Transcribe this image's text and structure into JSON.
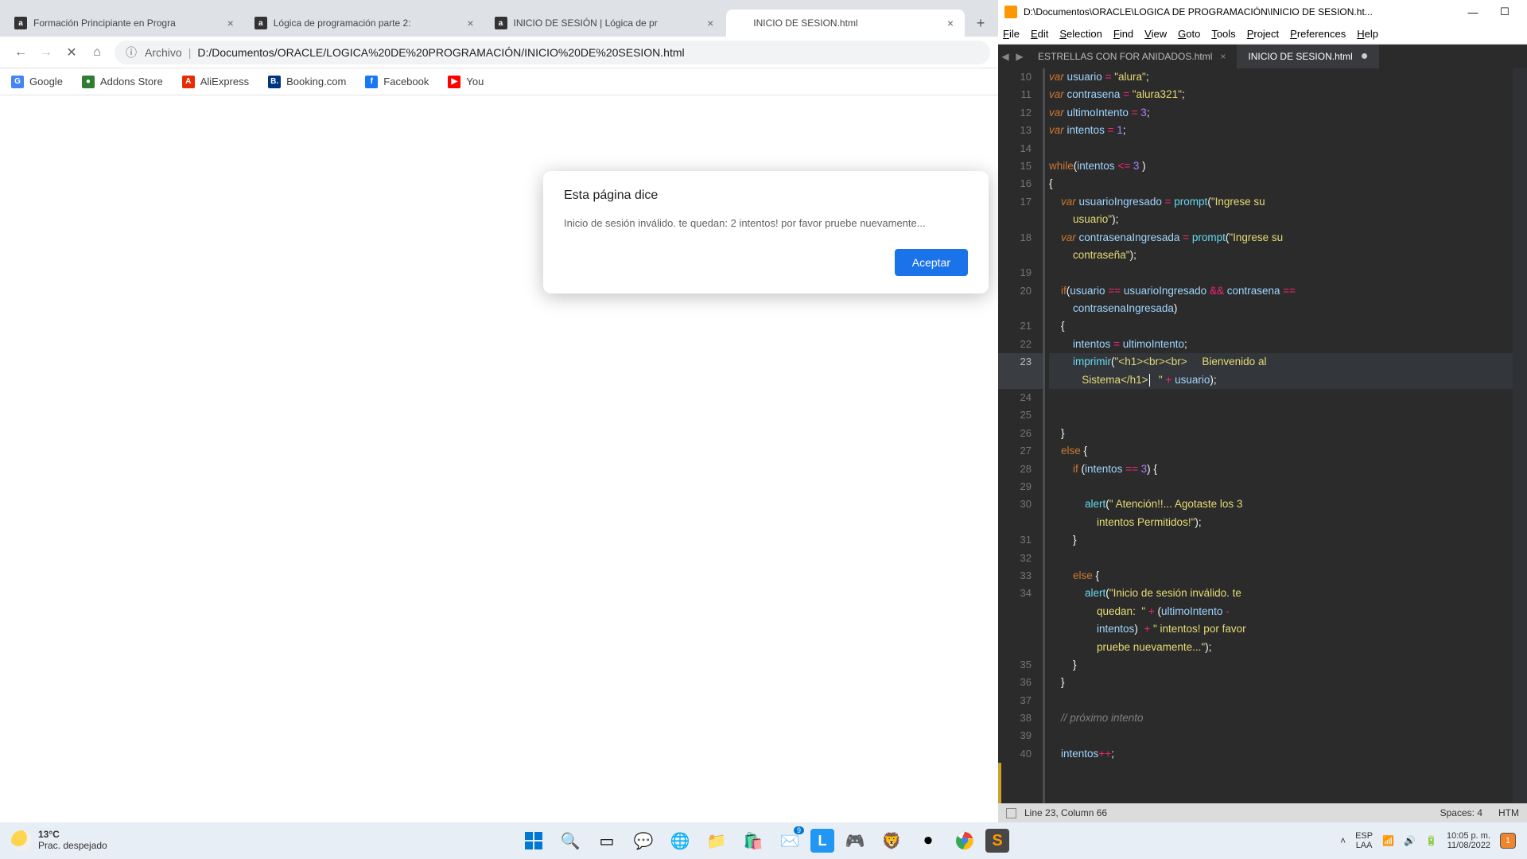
{
  "chrome": {
    "tabs": [
      {
        "title": "Formación Principiante en Progra"
      },
      {
        "title": "Lógica de programación parte 2:"
      },
      {
        "title": "INICIO DE SESIÓN | Lógica de pr"
      },
      {
        "title": "INICIO DE SESION.html"
      }
    ],
    "address": {
      "info_label": "Archivo",
      "url": "D:/Documentos/ORACLE/LOGICA%20DE%20PROGRAMACIÓN/INICIO%20DE%20SESION.html"
    },
    "bookmarks": [
      {
        "label": "Google",
        "color": "#4285f4",
        "glyph": "G"
      },
      {
        "label": "Addons Store",
        "color": "#2e7d32",
        "glyph": "●"
      },
      {
        "label": "AliExpress",
        "color": "#e62e04",
        "glyph": "A"
      },
      {
        "label": "Booking.com",
        "color": "#003580",
        "glyph": "B."
      },
      {
        "label": "Facebook",
        "color": "#1877f2",
        "glyph": "f"
      },
      {
        "label": "You",
        "color": "#ff0000",
        "glyph": "▶"
      }
    ],
    "dialog": {
      "title": "Esta página dice",
      "message": "Inicio de sesión inválido. te quedan:  2 intentos! por favor pruebe nuevamente...",
      "ok": "Aceptar"
    }
  },
  "sublime": {
    "title": "D:\\Documentos\\ORACLE\\LOGICA DE PROGRAMACIÓN\\INICIO DE SESION.ht...",
    "menu": [
      "File",
      "Edit",
      "Selection",
      "Find",
      "View",
      "Goto",
      "Tools",
      "Project",
      "Preferences",
      "Help"
    ],
    "tabs": [
      {
        "label": "ESTRELLAS CON FOR ANIDADOS.html",
        "active": false,
        "dirty": false
      },
      {
        "label": "INICIO DE SESION.html",
        "active": true,
        "dirty": true
      }
    ],
    "first_line": 10,
    "highlight_line": 23,
    "code_lines": [
      {
        "n": 10,
        "html": "<span class='kw'>var</span> <span class='var'>usuario</span> <span class='op'>=</span> <span class='str'>\"alura\"</span><span class='pn'>;</span>"
      },
      {
        "n": 11,
        "html": "<span class='kw'>var</span> <span class='var'>contrasena</span> <span class='op'>=</span> <span class='str'>\"alura321\"</span><span class='pn'>;</span>"
      },
      {
        "n": 12,
        "html": "<span class='kw'>var</span> <span class='var'>ultimoIntento</span> <span class='op'>=</span> <span class='num'>3</span><span class='pn'>;</span>"
      },
      {
        "n": 13,
        "html": "<span class='kw'>var</span> <span class='var'>intentos</span> <span class='op'>=</span> <span class='num'>1</span><span class='pn'>;</span>"
      },
      {
        "n": 14,
        "html": ""
      },
      {
        "n": 15,
        "html": "<span class='kw2'>while</span><span class='pn'>(</span><span class='var'>intentos</span> <span class='op'>&lt;=</span> <span class='num'>3</span> <span class='pn'>)</span>"
      },
      {
        "n": 16,
        "html": "<span class='pn'>{</span>"
      },
      {
        "n": 17,
        "html": "    <span class='kw'>var</span> <span class='var'>usuarioIngresado</span> <span class='op'>=</span> <span class='fn'>prompt</span><span class='pn'>(</span><span class='str'>\"Ingrese su </span>"
      },
      {
        "n": 0,
        "html": "        <span class='str'>usuario\"</span><span class='pn'>);</span>",
        "cont": true
      },
      {
        "n": 18,
        "html": "    <span class='kw'>var</span> <span class='var'>contrasenaIngresada</span> <span class='op'>=</span> <span class='fn'>prompt</span><span class='pn'>(</span><span class='str'>\"Ingrese su </span>"
      },
      {
        "n": 0,
        "html": "        <span class='str'>contraseña\"</span><span class='pn'>);</span>",
        "cont": true
      },
      {
        "n": 19,
        "html": ""
      },
      {
        "n": 20,
        "html": "    <span class='kw2'>if</span><span class='pn'>(</span><span class='var'>usuario</span> <span class='op'>==</span> <span class='var'>usuarioIngresado</span> <span class='op'>&amp;&amp;</span> <span class='var'>contrasena</span> <span class='op'>==</span>"
      },
      {
        "n": 0,
        "html": "        <span class='var'>contrasenaIngresada</span><span class='pn'>)</span>",
        "cont": true
      },
      {
        "n": 21,
        "html": "    <span class='pn'>{</span>"
      },
      {
        "n": 22,
        "html": "        <span class='var'>intentos</span> <span class='op'>=</span> <span class='var'>ultimoIntento</span><span class='pn'>;</span>"
      },
      {
        "n": 23,
        "html": "        <span class='fn'>imprimir</span><span class='pn'>(</span><span class='str'>\"&lt;h1&gt;&lt;br&gt;&lt;br&gt;     Bienvenido al </span>"
      },
      {
        "n": 0,
        "html": "           <span class='str'>Sistema&lt;/h1&gt;</span><span class='cursor'></span>   <span class='str'>\"</span> <span class='op'>+</span> <span class='var'>usuario</span><span class='pn'>);</span>",
        "cont": true,
        "hl": true
      },
      {
        "n": 24,
        "html": ""
      },
      {
        "n": 25,
        "html": ""
      },
      {
        "n": 26,
        "html": "    <span class='pn'>}</span>"
      },
      {
        "n": 27,
        "html": "    <span class='kw2'>else</span> <span class='pn'>{</span>"
      },
      {
        "n": 28,
        "html": "        <span class='kw2'>if</span> <span class='pn'>(</span><span class='var'>intentos</span> <span class='op'>==</span> <span class='num'>3</span><span class='pn'>) {</span>"
      },
      {
        "n": 29,
        "html": ""
      },
      {
        "n": 30,
        "html": "            <span class='fn'>alert</span><span class='pn'>(</span><span class='str'>\" Atención!!... Agotaste los 3 </span>"
      },
      {
        "n": 0,
        "html": "                <span class='str'>intentos Permitidos!\"</span><span class='pn'>);</span>",
        "cont": true
      },
      {
        "n": 31,
        "html": "        <span class='pn'>}</span>"
      },
      {
        "n": 32,
        "html": ""
      },
      {
        "n": 33,
        "html": "        <span class='kw2'>else</span> <span class='pn'>{</span>"
      },
      {
        "n": 34,
        "html": "            <span class='fn'>alert</span><span class='pn'>(</span><span class='str'>\"Inicio de sesión inválido. te </span>"
      },
      {
        "n": 0,
        "html": "                <span class='str'>quedan:  \"</span> <span class='op'>+</span> <span class='pn'>(</span><span class='var'>ultimoIntento</span> <span class='op'>-</span>",
        "cont": true
      },
      {
        "n": 0,
        "html": "                <span class='var'>intentos</span><span class='pn'>)</span>  <span class='op'>+</span> <span class='str'>\" intentos! por favor </span>",
        "cont": true
      },
      {
        "n": 0,
        "html": "                <span class='str'>pruebe nuevamente...\"</span><span class='pn'>);</span>",
        "cont": true
      },
      {
        "n": 35,
        "html": "        <span class='pn'>}</span>"
      },
      {
        "n": 36,
        "html": "    <span class='pn'>}</span>"
      },
      {
        "n": 37,
        "html": ""
      },
      {
        "n": 38,
        "html": "    <span class='cm'>// próximo intento</span>"
      },
      {
        "n": 39,
        "html": ""
      },
      {
        "n": 40,
        "html": "    <span class='var'>intentos</span><span class='op'>++</span><span class='pn'>;</span>"
      }
    ],
    "status": {
      "pos": "Line 23, Column 66",
      "spaces": "Spaces: 4",
      "syntax": "HTM"
    }
  },
  "taskbar": {
    "weather": {
      "temp": "13°C",
      "desc": "Prac. despejado"
    },
    "lang": {
      "top": "ESP",
      "bot": "LAA"
    },
    "clock": {
      "time": "10:05 p. m.",
      "date": "11/08/2022"
    },
    "notif_count": "1"
  }
}
